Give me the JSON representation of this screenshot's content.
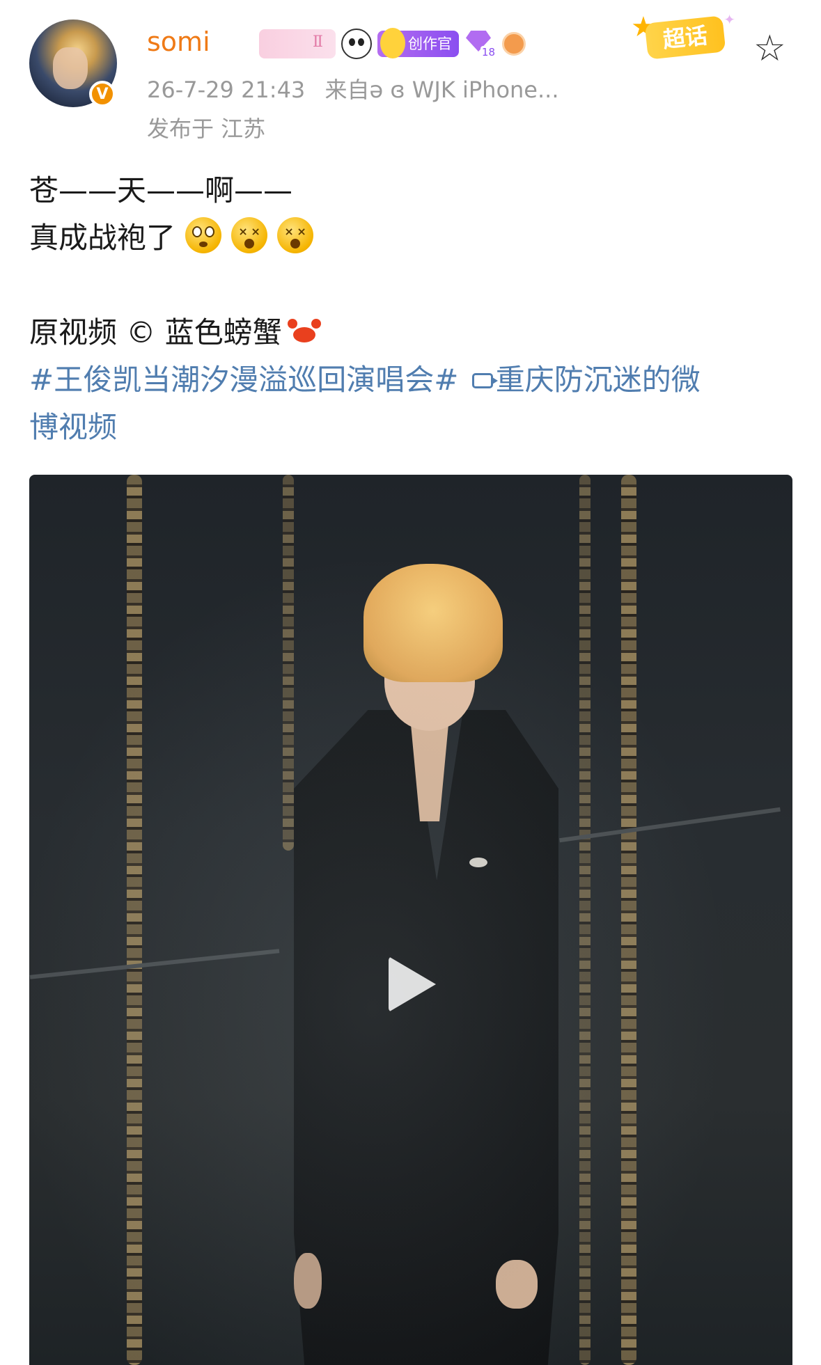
{
  "post": {
    "username": "somi",
    "verified_badge": "V",
    "timestamp": "26-7-29 21:43",
    "source": "来自ə ɞ WJK iPhone...",
    "location": "发布于 江苏",
    "badges": {
      "pink_level": "Ⅱ",
      "creator": "创作官",
      "gem_level": "18"
    },
    "chaohua_label": "超话",
    "favorite_icon": "star-outline-icon"
  },
  "content": {
    "line1": "苍——天——啊——",
    "line2": "真成战袍了",
    "credit_prefix": "原视频",
    "credit_symbol": "©",
    "credit_name": "蓝色螃蟹",
    "hashtag": "#王俊凯当潮汐漫溢巡回演唱会#",
    "video_link": "重庆防沉迷的微",
    "video_link_cont": "博视频"
  },
  "colors": {
    "username": "#ef7a16",
    "link": "#507daf",
    "meta": "#999999",
    "verified": "#f29100"
  },
  "video": {
    "play_icon": "play-icon"
  }
}
